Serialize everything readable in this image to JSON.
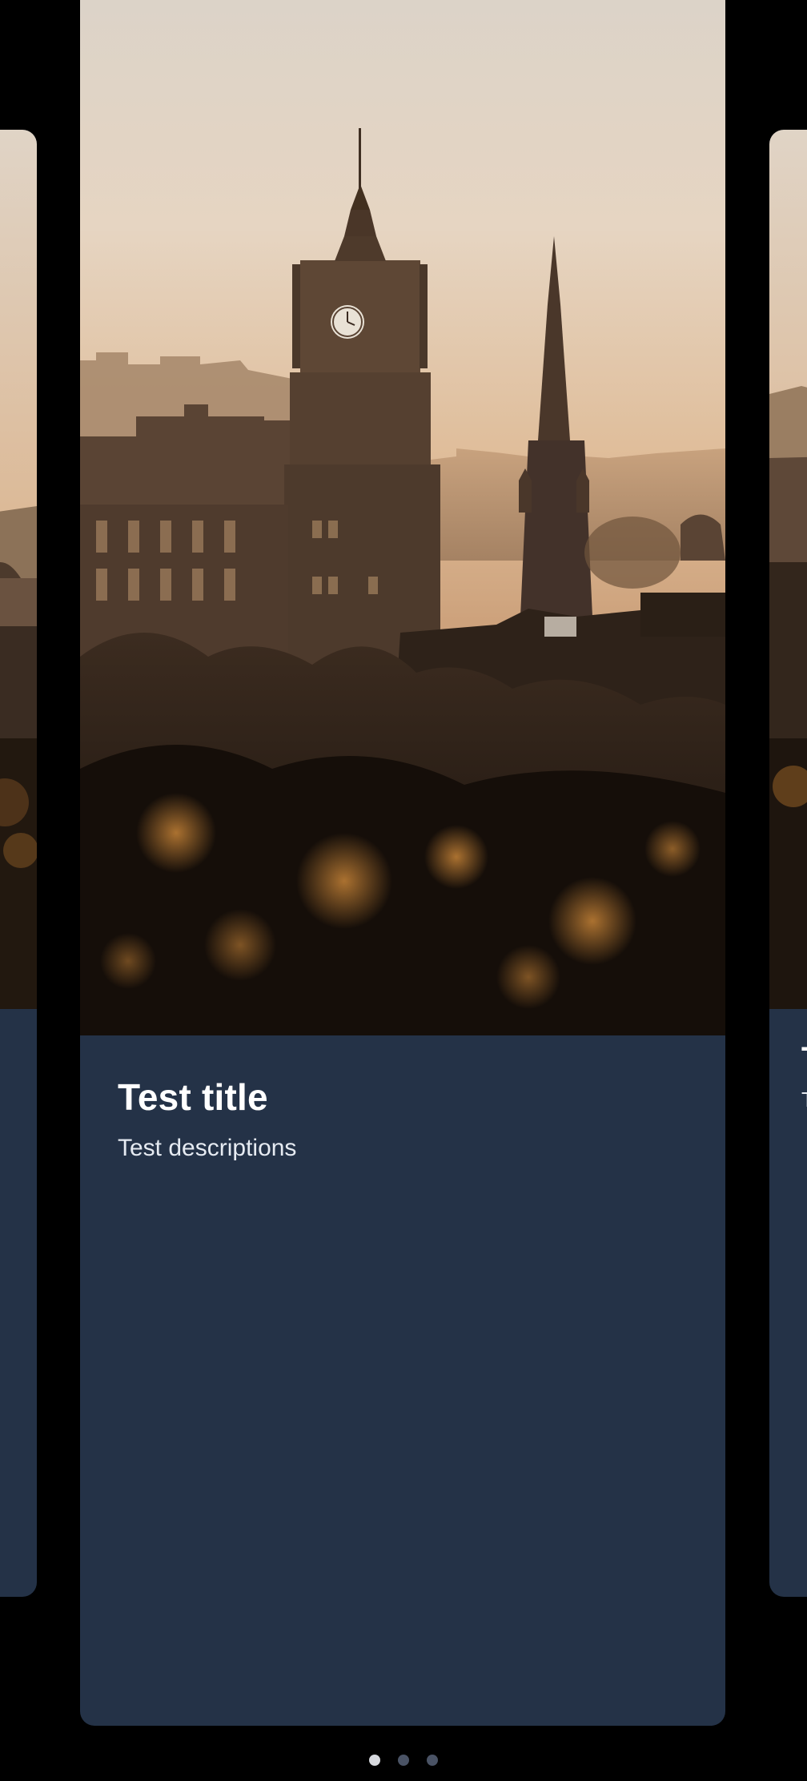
{
  "carousel": {
    "current_index": 0,
    "cards": [
      {
        "title": "Test title",
        "description": "Test descriptions"
      }
    ],
    "next_card": {
      "title": "T",
      "description": "T"
    },
    "page_count": 3
  },
  "colors": {
    "background": "#000000",
    "card_body": "#243247",
    "dot_active": "#d7d9de",
    "dot_inactive": "#4a5365"
  },
  "icons": [
    "pager-dot"
  ]
}
